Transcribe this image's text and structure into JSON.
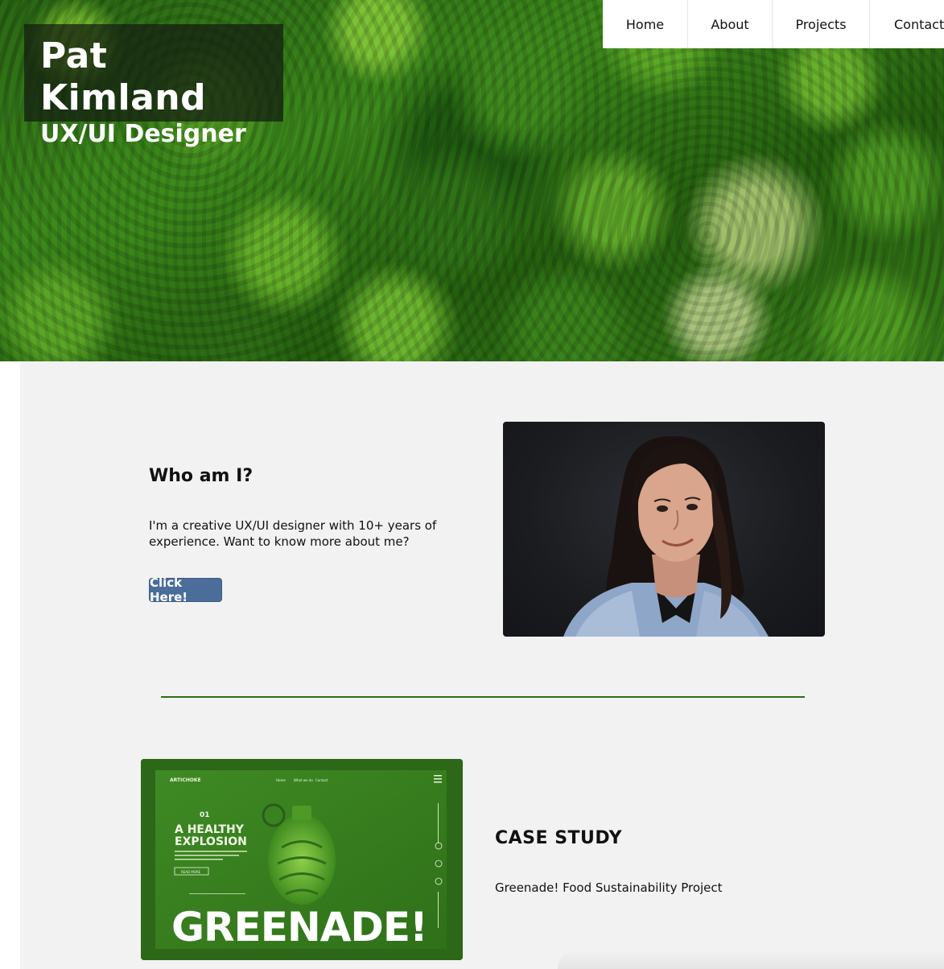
{
  "hero": {
    "name": "Pat Kimland",
    "role": "UX/UI Designer"
  },
  "nav": {
    "items": [
      "Home",
      "About",
      "Projects",
      "Contact"
    ]
  },
  "about": {
    "heading": "Who am I?",
    "text": "I'm a creative UX/UI designer with 10+ years of experience. Want to know more about me?",
    "button_label": "Click Here!"
  },
  "case_study": {
    "heading": "CASE STUDY",
    "text": "Greenade! Food Sustainability Project",
    "mockup": {
      "brand": "ARTICHOKE",
      "nav": [
        "Home",
        "What we do",
        "Contact"
      ],
      "number": "01",
      "headline_line1": "A HEALTHY",
      "headline_line2": "EXPLOSION",
      "button": "READ MORE",
      "big_title": "GREENADE!"
    }
  },
  "colors": {
    "accent_button": "#4a6d9a",
    "divider": "#2e6b1a",
    "main_bg": "#f2f2f2"
  }
}
